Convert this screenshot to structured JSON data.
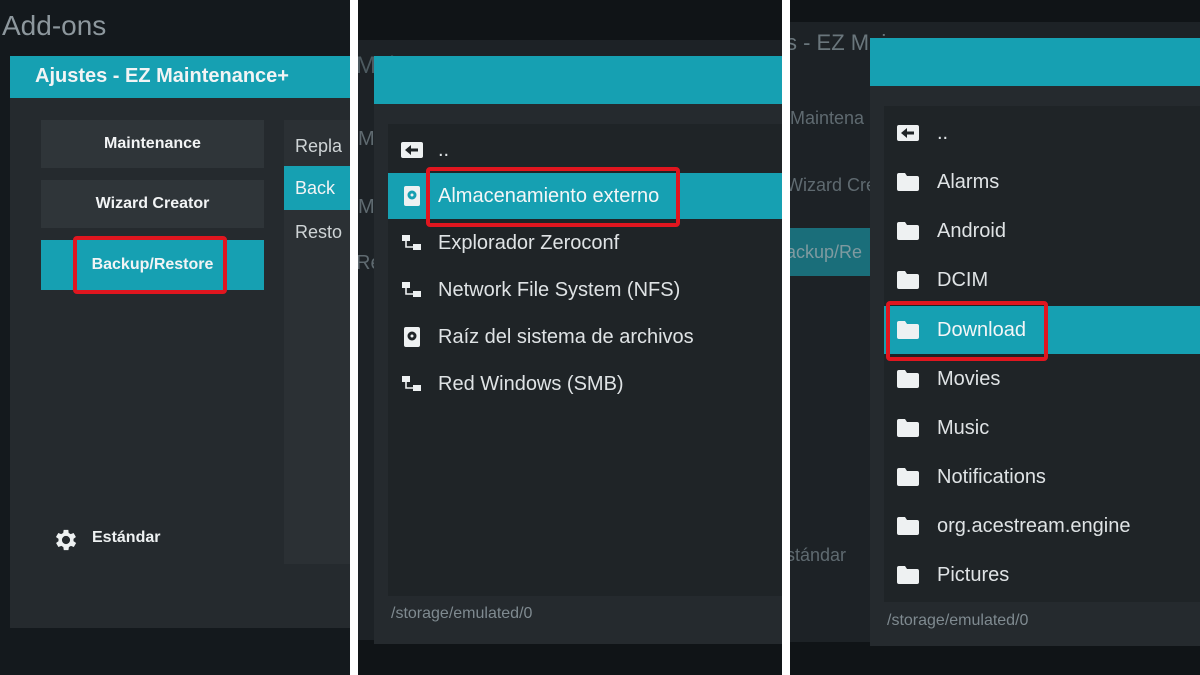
{
  "panel1": {
    "page_title": "Add-ons",
    "dialog_title": "Ajustes - EZ Maintenance+",
    "categories": [
      {
        "label": "Maintenance"
      },
      {
        "label": "Wizard Creator"
      },
      {
        "label": "Backup/Restore"
      }
    ],
    "options": [
      "Repla",
      "Back",
      "Resto"
    ],
    "settings_level": "Estándar"
  },
  "panel2": {
    "bg_title": "Mai",
    "bg_letters": [
      "M",
      "M",
      "Re"
    ],
    "items": [
      {
        "label": "..",
        "icon": "back-arrow-icon"
      },
      {
        "label": "Almacenamiento externo",
        "icon": "storage-icon"
      },
      {
        "label": "Explorador Zeroconf",
        "icon": "network-icon"
      },
      {
        "label": "Network File System (NFS)",
        "icon": "network-icon"
      },
      {
        "label": "Raíz del sistema de archivos",
        "icon": "storage-icon"
      },
      {
        "label": "Red Windows (SMB)",
        "icon": "network-icon"
      }
    ],
    "path": "/storage/emulated/0"
  },
  "panel3": {
    "bg_title": "s - EZ Mai",
    "bg_items": [
      "Maintena",
      "Wizard Cre",
      "ackup/Re",
      "stándar"
    ],
    "items": [
      {
        "label": "..",
        "icon": "back-arrow-icon"
      },
      {
        "label": "Alarms",
        "icon": "folder-icon"
      },
      {
        "label": "Android",
        "icon": "folder-icon"
      },
      {
        "label": "DCIM",
        "icon": "folder-icon"
      },
      {
        "label": "Download",
        "icon": "folder-icon"
      },
      {
        "label": "Movies",
        "icon": "folder-icon"
      },
      {
        "label": "Music",
        "icon": "folder-icon"
      },
      {
        "label": "Notifications",
        "icon": "folder-icon"
      },
      {
        "label": "org.acestream.engine",
        "icon": "folder-icon"
      },
      {
        "label": "Pictures",
        "icon": "folder-icon"
      }
    ],
    "path": "/storage/emulated/0"
  },
  "colors": {
    "accent": "#16a0b2",
    "highlight_border": "#e0161f",
    "dialog_bg": "#252a2e"
  }
}
